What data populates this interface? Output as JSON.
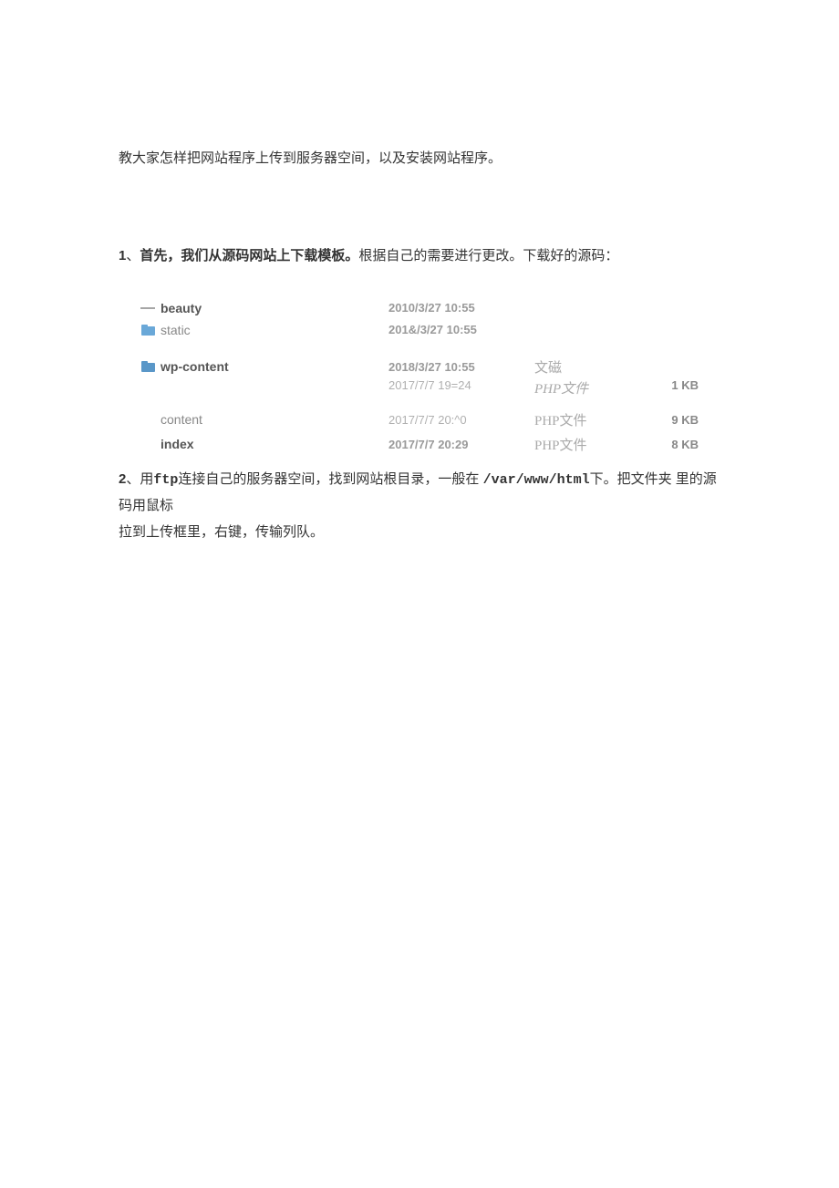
{
  "intro": "教大家怎样把网站程序上传到服务器空间，以及安装网站程序。",
  "step1": {
    "num": "1",
    "sep": "、",
    "bold": "首先，我们从源码网站上下载模板。",
    "rest": "根据自己的需要进行更改。下载好的源码："
  },
  "files": [
    {
      "name": "beauty",
      "date": "2010/3/27 10:55",
      "type": "",
      "size": "",
      "icon": "line",
      "name_cls": "col-name strong",
      "date_cls": "col-date"
    },
    {
      "name": "static",
      "date": "201&/3/27 10:55",
      "type": "",
      "size": "",
      "icon": "folder",
      "name_cls": "col-name light",
      "date_cls": "col-date"
    },
    {
      "name": "wp-content",
      "date": "2018/3/27 10:55",
      "type": "文磁",
      "size": "",
      "icon": "folder2",
      "name_cls": "col-name strong",
      "date_cls": "col-date"
    },
    {
      "name": "",
      "date": "2017/7/7 19=24",
      "type": "PHP文件",
      "size": "1 KB",
      "icon": "",
      "name_cls": "col-name",
      "date_cls": "col-date light",
      "sub": true
    },
    {
      "name": "content",
      "date": "2017/7/7 20:^0",
      "type": "PHP文件",
      "size": "9 KB",
      "icon": "none",
      "name_cls": "col-name light",
      "date_cls": "col-date light"
    },
    {
      "name": "index",
      "date": "2017/7/7 20:29",
      "type": "PHP文件",
      "size": "8 KB",
      "icon": "none",
      "name_cls": "col-name strong",
      "date_cls": "col-date"
    }
  ],
  "step2": {
    "num": "2",
    "sep": "、",
    "p1_a": "用",
    "p1_ftp": "ftp",
    "p1_b": "连接自己的服务器空间，找到网站根目录，一般在 ",
    "path": "/var/www/html",
    "p1_c": "下。把文件夹  里的源码用鼠标",
    "p2": "拉到上传框里，右键，传输列队。"
  }
}
